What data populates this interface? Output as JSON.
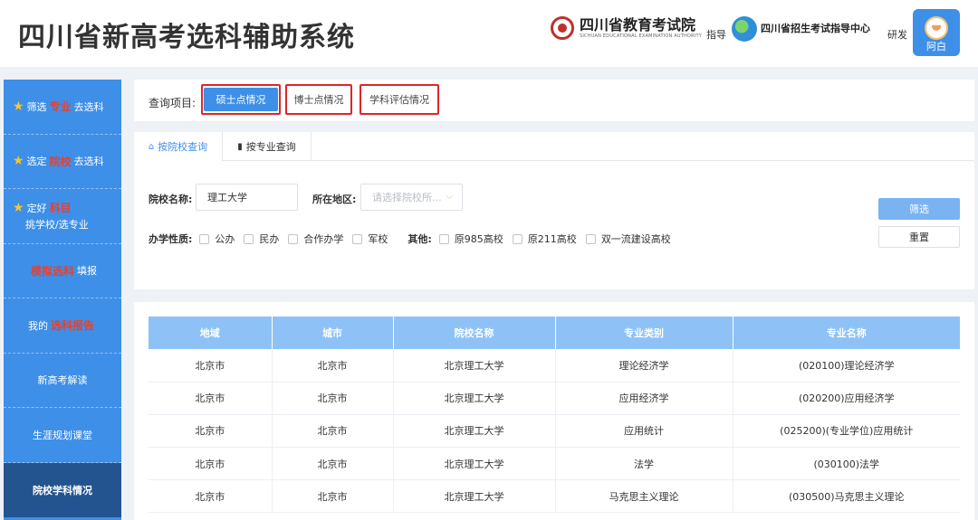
{
  "header": {
    "title": "四川省新高考选科辅助系统",
    "org1_name": "四川省教育考试院",
    "org1_en": "SICHUAN EDUCATIONAL EXAMINATION AUTHORITY",
    "guide_label": "指导",
    "org2_name": "四川省招生考试指导中心",
    "dev_label": "研发",
    "user_name": "阿白"
  },
  "sidebar": {
    "items": [
      {
        "prefix": "筛选",
        "highlight": "专业",
        "suffix": "去选科"
      },
      {
        "prefix": "选定",
        "highlight": "院校",
        "suffix": "去选科"
      },
      {
        "prefix": "定好",
        "highlight": "科目",
        "line2": "挑学校/选专业"
      },
      {
        "highlight": "模拟选科",
        "suffix": "填报"
      },
      {
        "prefix": "我的",
        "highlight": "选科报告"
      },
      {
        "label": "新高考解读"
      },
      {
        "label": "生涯规划课堂"
      },
      {
        "label": "院校学科情况"
      }
    ]
  },
  "query": {
    "label": "查询项目:",
    "buttons": [
      "硕士点情况",
      "博士点情况",
      "学科评估情况"
    ]
  },
  "tabs": {
    "by_school": "按院校查询",
    "by_major": "按专业查询"
  },
  "filter": {
    "school_label": "院校名称:",
    "school_value": "理工大学",
    "region_label": "所在地区:",
    "region_placeholder": "请选择院校所...",
    "nature_label": "办学性质:",
    "nature_options": [
      "公办",
      "民办",
      "合作办学",
      "军校"
    ],
    "other_label": "其他:",
    "other_options": [
      "原985高校",
      "原211高校",
      "双一流建设高校"
    ],
    "filter_button": "筛选",
    "reset_button": "重置"
  },
  "table": {
    "headers": [
      "地域",
      "城市",
      "院校名称",
      "专业类别",
      "专业名称"
    ],
    "rows": [
      [
        "北京市",
        "北京市",
        "北京理工大学",
        "理论经济学",
        "(020100)理论经济学"
      ],
      [
        "北京市",
        "北京市",
        "北京理工大学",
        "应用经济学",
        "(020200)应用经济学"
      ],
      [
        "北京市",
        "北京市",
        "北京理工大学",
        "应用统计",
        "(025200)(专业学位)应用统计"
      ],
      [
        "北京市",
        "北京市",
        "北京理工大学",
        "法学",
        "(030100)法学"
      ],
      [
        "北京市",
        "北京市",
        "北京理工大学",
        "马克思主义理论",
        "(030500)马克思主义理论"
      ]
    ]
  },
  "colors": {
    "primary": "#3e8fe8",
    "highlight_red": "#e0242a",
    "sidebar_active": "#23548f",
    "table_header": "#8ec2f7"
  }
}
